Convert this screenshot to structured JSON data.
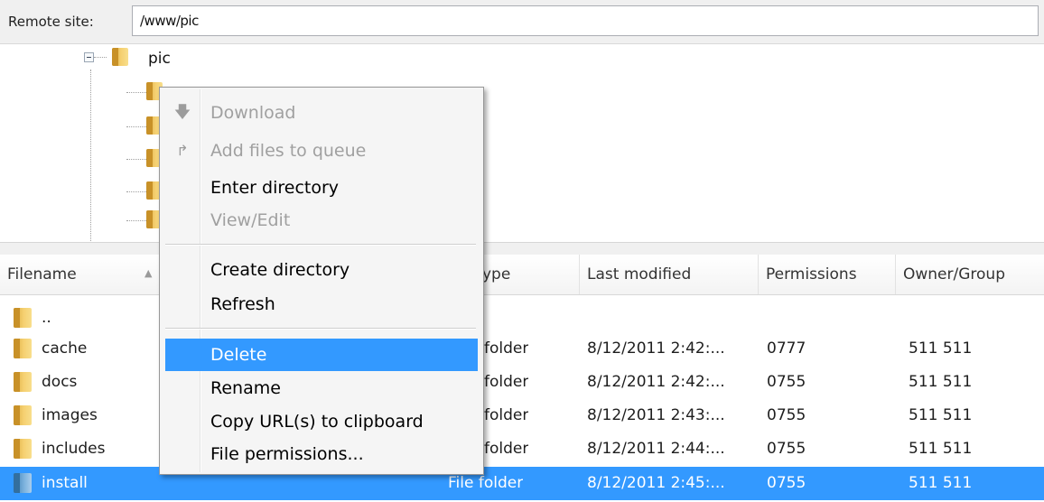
{
  "site_bar": {
    "label": "Remote site:",
    "path": "/www/pic"
  },
  "tree": {
    "root_label": "pic",
    "child_count_visible": 6
  },
  "file_list": {
    "columns": [
      "Filename",
      "Filetype",
      "Last modified",
      "Permissions",
      "Owner/Group"
    ],
    "visible_header_filetype": "ype",
    "rows": [
      {
        "name": "..",
        "type": "",
        "modified": "",
        "permissions": "",
        "owner": "",
        "selected": false
      },
      {
        "name": "cache",
        "type": "folder",
        "modified": "8/12/2011 2:42:...",
        "permissions": "0777",
        "owner": "511 511",
        "selected": false
      },
      {
        "name": "docs",
        "type": "folder",
        "modified": "8/12/2011 2:42:...",
        "permissions": "0755",
        "owner": "511 511",
        "selected": false
      },
      {
        "name": "images",
        "type": "folder",
        "modified": "8/12/2011 2:43:...",
        "permissions": "0755",
        "owner": "511 511",
        "selected": false
      },
      {
        "name": "includes",
        "type": "folder",
        "modified": "8/12/2011 2:44:...",
        "permissions": "0755",
        "owner": "511 511",
        "selected": false
      },
      {
        "name": "install",
        "type": "File folder",
        "modified": "8/12/2011 2:45:...",
        "permissions": "0755",
        "owner": "511 511",
        "selected": true
      }
    ]
  },
  "context_menu": {
    "items": [
      {
        "label": "Download",
        "enabled": false,
        "icon": "download-arrow-icon"
      },
      {
        "label": "Add files to queue",
        "enabled": false,
        "icon": "add-to-queue-icon"
      },
      {
        "label": "Enter directory",
        "enabled": true
      },
      {
        "label": "View/Edit",
        "enabled": false
      },
      {
        "label": "Create directory",
        "enabled": true
      },
      {
        "label": "Refresh",
        "enabled": true
      },
      {
        "label": "Delete",
        "enabled": true,
        "highlighted": true
      },
      {
        "label": "Rename",
        "enabled": true
      },
      {
        "label": "Copy URL(s) to clipboard",
        "enabled": true
      },
      {
        "label": "File permissions...",
        "enabled": true
      }
    ]
  },
  "colors": {
    "selection": "#3399ff",
    "disabled_text": "#a0a0a0",
    "folder_yellow": "#f5d070",
    "folder_blue": "#7db3de"
  }
}
